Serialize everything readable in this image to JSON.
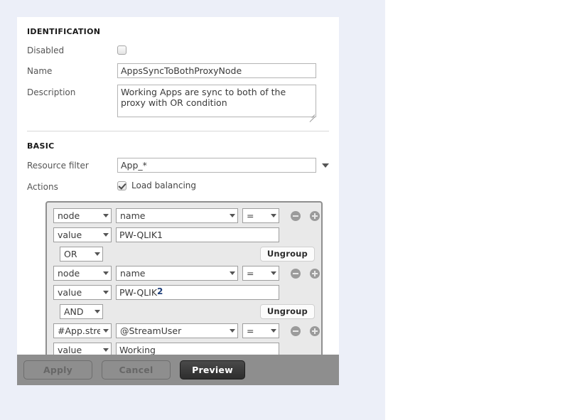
{
  "identification": {
    "section_title": "IDENTIFICATION",
    "disabled_label": "Disabled",
    "disabled_checked": false,
    "name_label": "Name",
    "name_value": "AppsSyncToBothProxyNode",
    "description_label": "Description",
    "description_value": "Working Apps are sync to both of the proxy with OR condition"
  },
  "basic": {
    "section_title": "BASIC",
    "resource_filter_label": "Resource filter",
    "resource_filter_value": "App_*",
    "actions_label": "Actions",
    "load_balancing_label": "Load balancing",
    "load_balancing_checked": true
  },
  "conditions": {
    "rows": [
      {
        "kind": "condition",
        "left": "node",
        "field": "name",
        "operator": "=",
        "minus_icon": "minus-circle-icon",
        "plus_icon": "plus-circle-icon"
      },
      {
        "kind": "value",
        "left": "value",
        "value": "PW-QLIK1"
      },
      {
        "kind": "logic",
        "logic": "OR",
        "ungroup_label": "Ungroup"
      },
      {
        "kind": "condition",
        "left": "node",
        "field": "name",
        "operator": "=",
        "minus_icon": "minus-circle-icon",
        "plus_icon": "plus-circle-icon"
      },
      {
        "kind": "value",
        "left": "value",
        "value": "PW-QLIK"
      },
      {
        "kind": "logic",
        "logic": "AND",
        "ungroup_label": "Ungroup"
      },
      {
        "kind": "condition",
        "left": "#App.stre",
        "field": "@StreamUser",
        "operator": "=",
        "minus_icon": "minus-circle-icon",
        "plus_icon": "plus-circle-icon"
      },
      {
        "kind": "value",
        "left": "value",
        "value": "Working"
      }
    ]
  },
  "annotations": [
    {
      "label": "2",
      "color": "#1f3f7a"
    }
  ],
  "footer": {
    "apply_label": "Apply",
    "cancel_label": "Cancel",
    "preview_label": "Preview"
  },
  "colors": {
    "page_background": "#eceff8",
    "panel_background": "#ffffff",
    "footer_background": "#8e8e8e",
    "condition_box_background": "#e9e9e9",
    "condition_box_border": "#8f8f8f",
    "primary_button": "#2d2d2d",
    "annotation": "#1f3f7a"
  }
}
